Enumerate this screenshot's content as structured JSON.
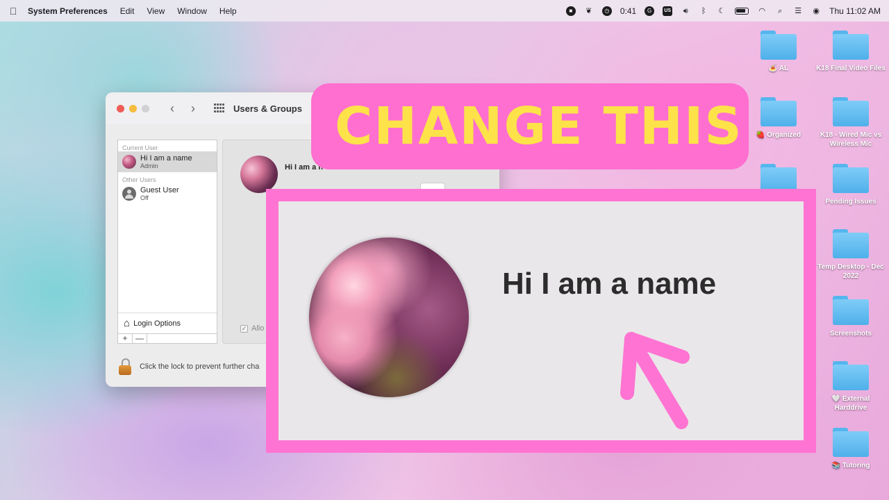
{
  "menubar": {
    "app_name": "System Preferences",
    "menus": [
      "Edit",
      "View",
      "Window",
      "Help"
    ],
    "timer": "0:41",
    "input_source": "US",
    "clock": "Thu  11:02 AM"
  },
  "window": {
    "title": "Users & Groups",
    "current_user_header": "Current User",
    "other_users_header": "Other Users",
    "users": [
      {
        "name": "Hi I am a name",
        "role": "Admin"
      },
      {
        "name": "Guest User",
        "role": "Off"
      }
    ],
    "login_options": "Login Options",
    "plus": "+",
    "minus": "—",
    "detail_name": "Hi I am a n",
    "allow_text": "Allo",
    "lock_text": "Click the lock to prevent further cha"
  },
  "desktop": {
    "col1": [
      {
        "label": "AL",
        "emoji": "🍝"
      },
      {
        "label": "Organized",
        "emoji": "🍓"
      },
      {
        "label": "",
        "emoji": ""
      }
    ],
    "col2": [
      {
        "label": "K18 Final Video Files"
      },
      {
        "label": "K18 - Wired Mic vs Wireless Mic"
      },
      {
        "label": "Pending Issues"
      },
      {
        "label": "Temp Desktop - Dec 2022"
      },
      {
        "label": "Screenshots"
      },
      {
        "label": "🤍 External Harddrive"
      },
      {
        "label": "📚 Tutoring"
      }
    ]
  },
  "overlay": {
    "banner_text": "CHANGE THIS",
    "zoom_name": "Hi I am a name",
    "colors": {
      "pink": "#ff6fcf",
      "yellow": "#fde24a"
    }
  }
}
